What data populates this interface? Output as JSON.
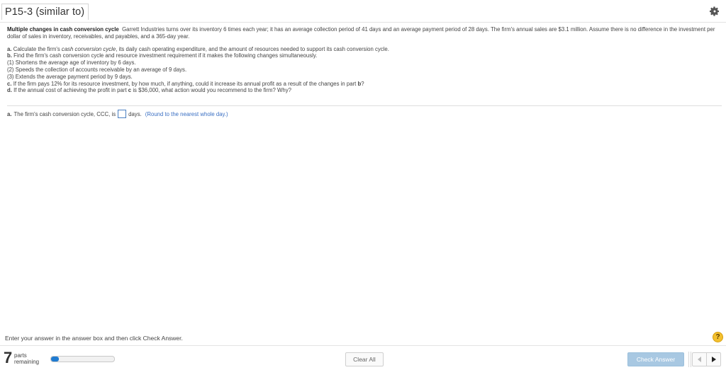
{
  "header": {
    "title": "P15-3 (similar to)",
    "settings_icon": "gear-icon"
  },
  "problem": {
    "heading": "Multiple changes in cash conversion cycle",
    "body": "Garrett Industries turns over its inventory 6 times each year; it has an average collection period of 41 days and an average payment period of 28 days. The firm's annual sales are $3.1 million. Assume there is no difference in the investment per dollar of sales in inventory, receivables, and payables, and a 365-day year."
  },
  "questions": {
    "a_label": "a.",
    "a_pre": "Calculate the firm's",
    "a_italic": "cash conversion cycle",
    "a_post": ", its daily cash operating expenditure, and the amount of resources needed to support its cash conversion cycle.",
    "b": "b.",
    "b_text": "Find the firm's cash conversion cycle and resource investment requirement if it makes the following changes simultaneously.",
    "c1": "(1)  Shortens the average age of inventory by 6 days.",
    "c2": "(2)  Speeds the collection of accounts receivable by an average of 9 days.",
    "c3": "(3)  Extends the average payment period by 9 days.",
    "c": "c.",
    "c_text": "If the firm pays 12% for its resource investment, by how much, if anything, could it increase its annual profit as a result of the changes in part",
    "c_bold": "b",
    "c_end": "?",
    "d": "d.",
    "d_text": "If the annual cost of achieving the profit in part",
    "d_bold": "c",
    "d_post": "is $36,000, what action would you recommend to the firm?  Why?"
  },
  "answer": {
    "label": "a.",
    "prefix": "The firm's cash conversion cycle, CCC, is",
    "value": "",
    "suffix": "days.",
    "hint": "(Round to the nearest whole day.)"
  },
  "instructions": "Enter your answer in the answer box and then click Check Answer.",
  "help_label": "?",
  "footer": {
    "parts_count": "7",
    "parts_label_1": "parts",
    "parts_label_2": "remaining",
    "progress_fraction": 0.12,
    "clear_label": "Clear All",
    "check_label": "Check Answer",
    "colors": {
      "progress": "#1f7bd1",
      "check_button": "#a8c8e2",
      "hint": "#3a6fc3",
      "help": "#f3c02e"
    }
  }
}
